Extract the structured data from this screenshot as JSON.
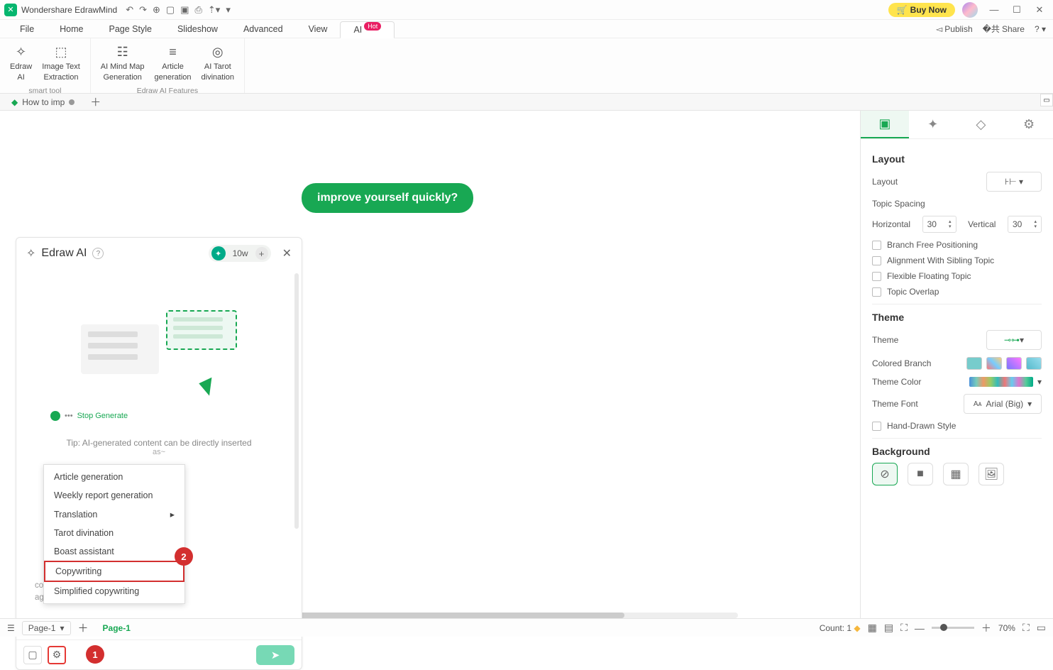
{
  "titlebar": {
    "title": "Wondershare EdrawMind",
    "buynow": "Buy Now"
  },
  "menu": {
    "items": [
      "File",
      "Home",
      "Page Style",
      "Slideshow",
      "Advanced",
      "View",
      "AI"
    ],
    "hot": "Hot",
    "publish": "Publish",
    "share": "Share"
  },
  "ribbon": {
    "smart": [
      {
        "label1": "Edraw",
        "label2": "AI"
      },
      {
        "label1": "Image Text",
        "label2": "Extraction"
      }
    ],
    "smart_label": "smart tool",
    "features": [
      {
        "label1": "AI Mind Map",
        "label2": "Generation"
      },
      {
        "label1": "Article",
        "label2": "generation"
      },
      {
        "label1": "AI Tarot",
        "label2": "divination"
      }
    ],
    "features_label": "Edraw AI Features"
  },
  "doctab": {
    "name": "How to imp"
  },
  "canvas": {
    "topic": "improve yourself quickly?"
  },
  "ai": {
    "title": "Edraw AI",
    "tokens": "10w",
    "stop": "Stop Generate",
    "tip": "Tip: AI-generated content can be directly inserted",
    "tip2": "as~",
    "hint1": "continuous free conversation",
    "hint2": "age, and use Shift+Enter for line"
  },
  "ctx": {
    "items": [
      "Article generation",
      "Weekly report generation",
      "Translation",
      "Tarot divination",
      "Boast assistant",
      "Copywriting",
      "Simplified copywriting"
    ]
  },
  "badges": {
    "b1": "1",
    "b2": "2"
  },
  "side": {
    "layout_title": "Layout",
    "layout_label": "Layout",
    "spacing": "Topic Spacing",
    "horizontal": "Horizontal",
    "h_val": "30",
    "vertical": "Vertical",
    "v_val": "30",
    "chk1": "Branch Free Positioning",
    "chk2": "Alignment With Sibling Topic",
    "chk3": "Flexible Floating Topic",
    "chk4": "Topic Overlap",
    "theme_title": "Theme",
    "theme_label": "Theme",
    "colored": "Colored Branch",
    "theme_color": "Theme Color",
    "theme_font": "Theme Font",
    "font_val": "Arial (Big)",
    "hand": "Hand-Drawn Style",
    "bg_title": "Background"
  },
  "status": {
    "page_sel": "Page-1",
    "page_tab": "Page-1",
    "count": "Count: 1",
    "zoom": "70%"
  }
}
